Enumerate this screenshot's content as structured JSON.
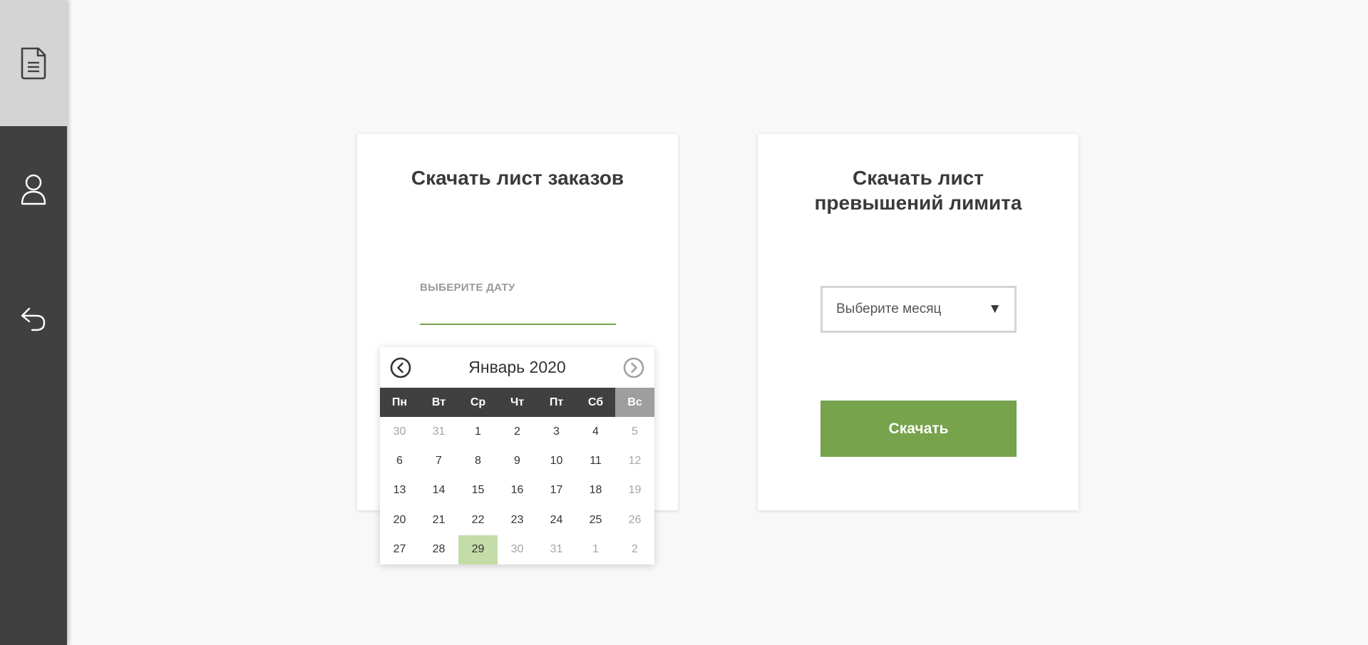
{
  "sidebar": {
    "items": [
      {
        "name": "document-icon",
        "active": true
      },
      {
        "name": "user-icon",
        "active": false
      },
      {
        "name": "undo-icon",
        "active": false
      }
    ]
  },
  "orders_card": {
    "title": "Скачать лист заказов",
    "date_label": "ВЫБЕРИТЕ ДАТУ",
    "date_value": ""
  },
  "limits_card": {
    "title_line1": "Скачать лист",
    "title_line2": "превышений лимита",
    "month_select_placeholder": "Выберите месяц",
    "download_label": "Скачать"
  },
  "calendar": {
    "month_title": "Январь 2020",
    "weekdays": [
      "Пн",
      "Вт",
      "Ср",
      "Чт",
      "Пт",
      "Сб",
      "Вс"
    ],
    "days": [
      {
        "d": "30",
        "muted": true
      },
      {
        "d": "31",
        "muted": true
      },
      {
        "d": "1"
      },
      {
        "d": "2"
      },
      {
        "d": "3"
      },
      {
        "d": "4"
      },
      {
        "d": "5",
        "muted": true
      },
      {
        "d": "6"
      },
      {
        "d": "7"
      },
      {
        "d": "8"
      },
      {
        "d": "9"
      },
      {
        "d": "10"
      },
      {
        "d": "11"
      },
      {
        "d": "12",
        "muted": true
      },
      {
        "d": "13"
      },
      {
        "d": "14"
      },
      {
        "d": "15"
      },
      {
        "d": "16"
      },
      {
        "d": "17"
      },
      {
        "d": "18"
      },
      {
        "d": "19",
        "muted": true
      },
      {
        "d": "20"
      },
      {
        "d": "21"
      },
      {
        "d": "22"
      },
      {
        "d": "23"
      },
      {
        "d": "24"
      },
      {
        "d": "25"
      },
      {
        "d": "26",
        "muted": true
      },
      {
        "d": "27"
      },
      {
        "d": "28"
      },
      {
        "d": "29",
        "selected": true
      },
      {
        "d": "30",
        "muted": true
      },
      {
        "d": "31",
        "muted": true
      },
      {
        "d": "1",
        "muted": true
      },
      {
        "d": "2",
        "muted": true
      }
    ]
  },
  "colors": {
    "sidebar_bg": "#404040",
    "accent_green": "#76a34b",
    "selected_day": "#c4dca8",
    "weekend_header": "#9e9e9e"
  }
}
